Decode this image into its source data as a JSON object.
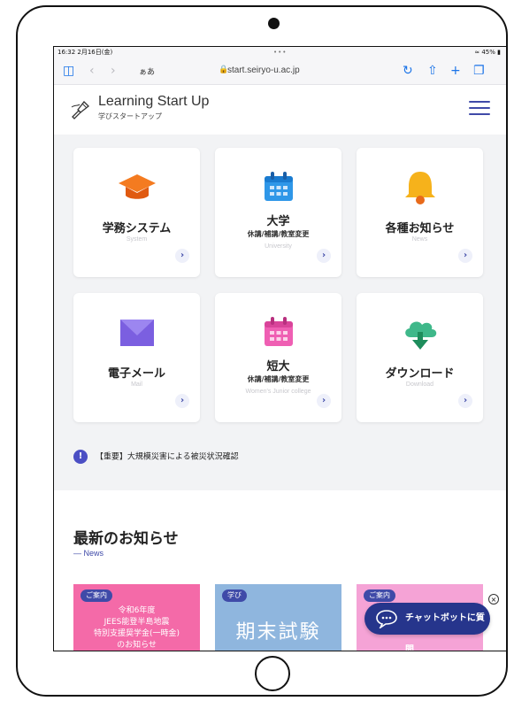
{
  "status_bar": {
    "time": "16:32 2月16日(金)",
    "dots": "•••",
    "battery": "45%"
  },
  "browser": {
    "text_size": "ぁあ",
    "url": "start.seiryo-u.ac.jp"
  },
  "header": {
    "title": "Learning Start Up",
    "subtitle": "学びスタートアップ"
  },
  "tiles": [
    {
      "title": "学務システム",
      "subtitle": "",
      "en": "System",
      "color": "#f47b20"
    },
    {
      "title": "大学",
      "subtitle": "休講/補講/教室変更",
      "en": "University",
      "color": "#2f97e8"
    },
    {
      "title": "各種お知らせ",
      "subtitle": "",
      "en": "News",
      "color": "#f6b21b"
    },
    {
      "title": "電子メール",
      "subtitle": "",
      "en": "Mail",
      "color": "#7b5fe0"
    },
    {
      "title": "短大",
      "subtitle": "休講/補講/教室変更",
      "en": "Women's Junior college",
      "color": "#ef5fb3"
    },
    {
      "title": "ダウンロード",
      "subtitle": "",
      "en": "Download",
      "color": "#2fb07a"
    }
  ],
  "tile_arrow": "›",
  "alert": {
    "icon": "!",
    "text": "【重要】大規模災害による被災状況確認"
  },
  "news": {
    "title": "最新のお知らせ",
    "subtitle": "— News",
    "cards": [
      {
        "badge": "ご案内",
        "line1": "令和6年度",
        "line2": "JEES能登半島地震",
        "line3": "特別支援奨学金(一時金)",
        "line4": "のお知らせ",
        "color": "#f46aa8"
      },
      {
        "badge": "学び",
        "big": "期末試験",
        "color": "#8fb6de"
      },
      {
        "badge": "ご案内",
        "color": "#f5a3d6"
      }
    ]
  },
  "chatbot": {
    "label": "チャットボットに質問",
    "close": "×"
  }
}
